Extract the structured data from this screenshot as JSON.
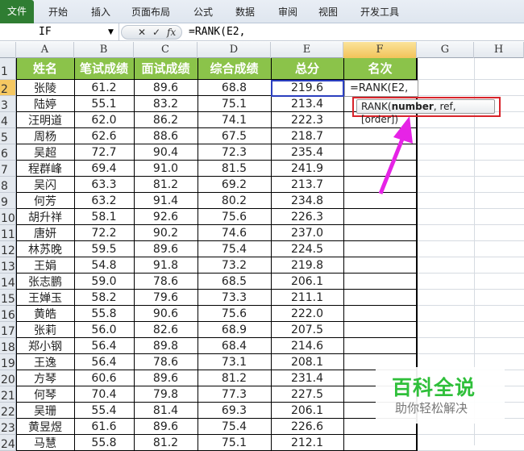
{
  "ribbon": {
    "file": "文件",
    "tabs": [
      "开始",
      "插入",
      "页面布局",
      "公式",
      "数据",
      "审阅",
      "视图",
      "开发工具"
    ]
  },
  "formula_bar": {
    "name_box": "IF",
    "cancel": "✕",
    "enter": "✓",
    "fx": "fx",
    "formula": "=RANK(E2,"
  },
  "columns": [
    "A",
    "B",
    "C",
    "D",
    "E",
    "F",
    "G",
    "H"
  ],
  "headers": [
    "姓名",
    "笔试成绩",
    "面试成绩",
    "综合成绩",
    "总分",
    "名次"
  ],
  "rows": [
    [
      "张陵",
      "61.2",
      "89.6",
      "68.8",
      "219.6"
    ],
    [
      "陆婷",
      "55.1",
      "83.2",
      "75.1",
      "213.4"
    ],
    [
      "汪明道",
      "62.0",
      "86.2",
      "74.1",
      "222.3"
    ],
    [
      "周杨",
      "62.6",
      "88.6",
      "67.5",
      "218.7"
    ],
    [
      "吴超",
      "72.7",
      "90.4",
      "72.3",
      "235.4"
    ],
    [
      "程群峰",
      "69.4",
      "91.0",
      "81.5",
      "241.9"
    ],
    [
      "吴闪",
      "63.3",
      "81.2",
      "69.2",
      "213.7"
    ],
    [
      "何芳",
      "63.2",
      "91.4",
      "80.2",
      "234.8"
    ],
    [
      "胡升祥",
      "58.1",
      "92.6",
      "75.6",
      "226.3"
    ],
    [
      "唐妍",
      "72.2",
      "90.2",
      "74.6",
      "237.0"
    ],
    [
      "林苏晚",
      "59.5",
      "89.6",
      "75.4",
      "224.5"
    ],
    [
      "王娟",
      "54.8",
      "91.8",
      "73.2",
      "219.8"
    ],
    [
      "张志鹏",
      "59.0",
      "78.6",
      "68.5",
      "206.1"
    ],
    [
      "王婵玉",
      "58.2",
      "79.6",
      "73.3",
      "211.1"
    ],
    [
      "黄皓",
      "55.8",
      "90.6",
      "75.6",
      "222.0"
    ],
    [
      "张莉",
      "56.0",
      "82.6",
      "68.9",
      "207.5"
    ],
    [
      "郑小钢",
      "56.4",
      "89.8",
      "68.4",
      "214.6"
    ],
    [
      "王逸",
      "56.4",
      "78.6",
      "73.1",
      "208.1"
    ],
    [
      "方琴",
      "60.6",
      "89.6",
      "81.2",
      "231.4"
    ],
    [
      "何琴",
      "70.4",
      "79.8",
      "77.3",
      "227.5"
    ],
    [
      "吴珊",
      "55.4",
      "81.4",
      "69.3",
      "206.1"
    ],
    [
      "黄昱煜",
      "61.6",
      "89.6",
      "75.4",
      "226.6"
    ],
    [
      "马慧",
      "55.8",
      "81.2",
      "75.1",
      "212.1"
    ]
  ],
  "active_cell_edit": "=RANK(E2,",
  "tooltip": {
    "fn": "RANK(",
    "arg_bold": "number",
    "rest": ", ref, [order])"
  },
  "watermark": {
    "title": "百科全说",
    "subtitle": "助你轻松解决"
  },
  "colors": {
    "header_green": "#8bc34a",
    "annotation_red": "#d8232a",
    "arrow_magenta": "#e623e6"
  }
}
